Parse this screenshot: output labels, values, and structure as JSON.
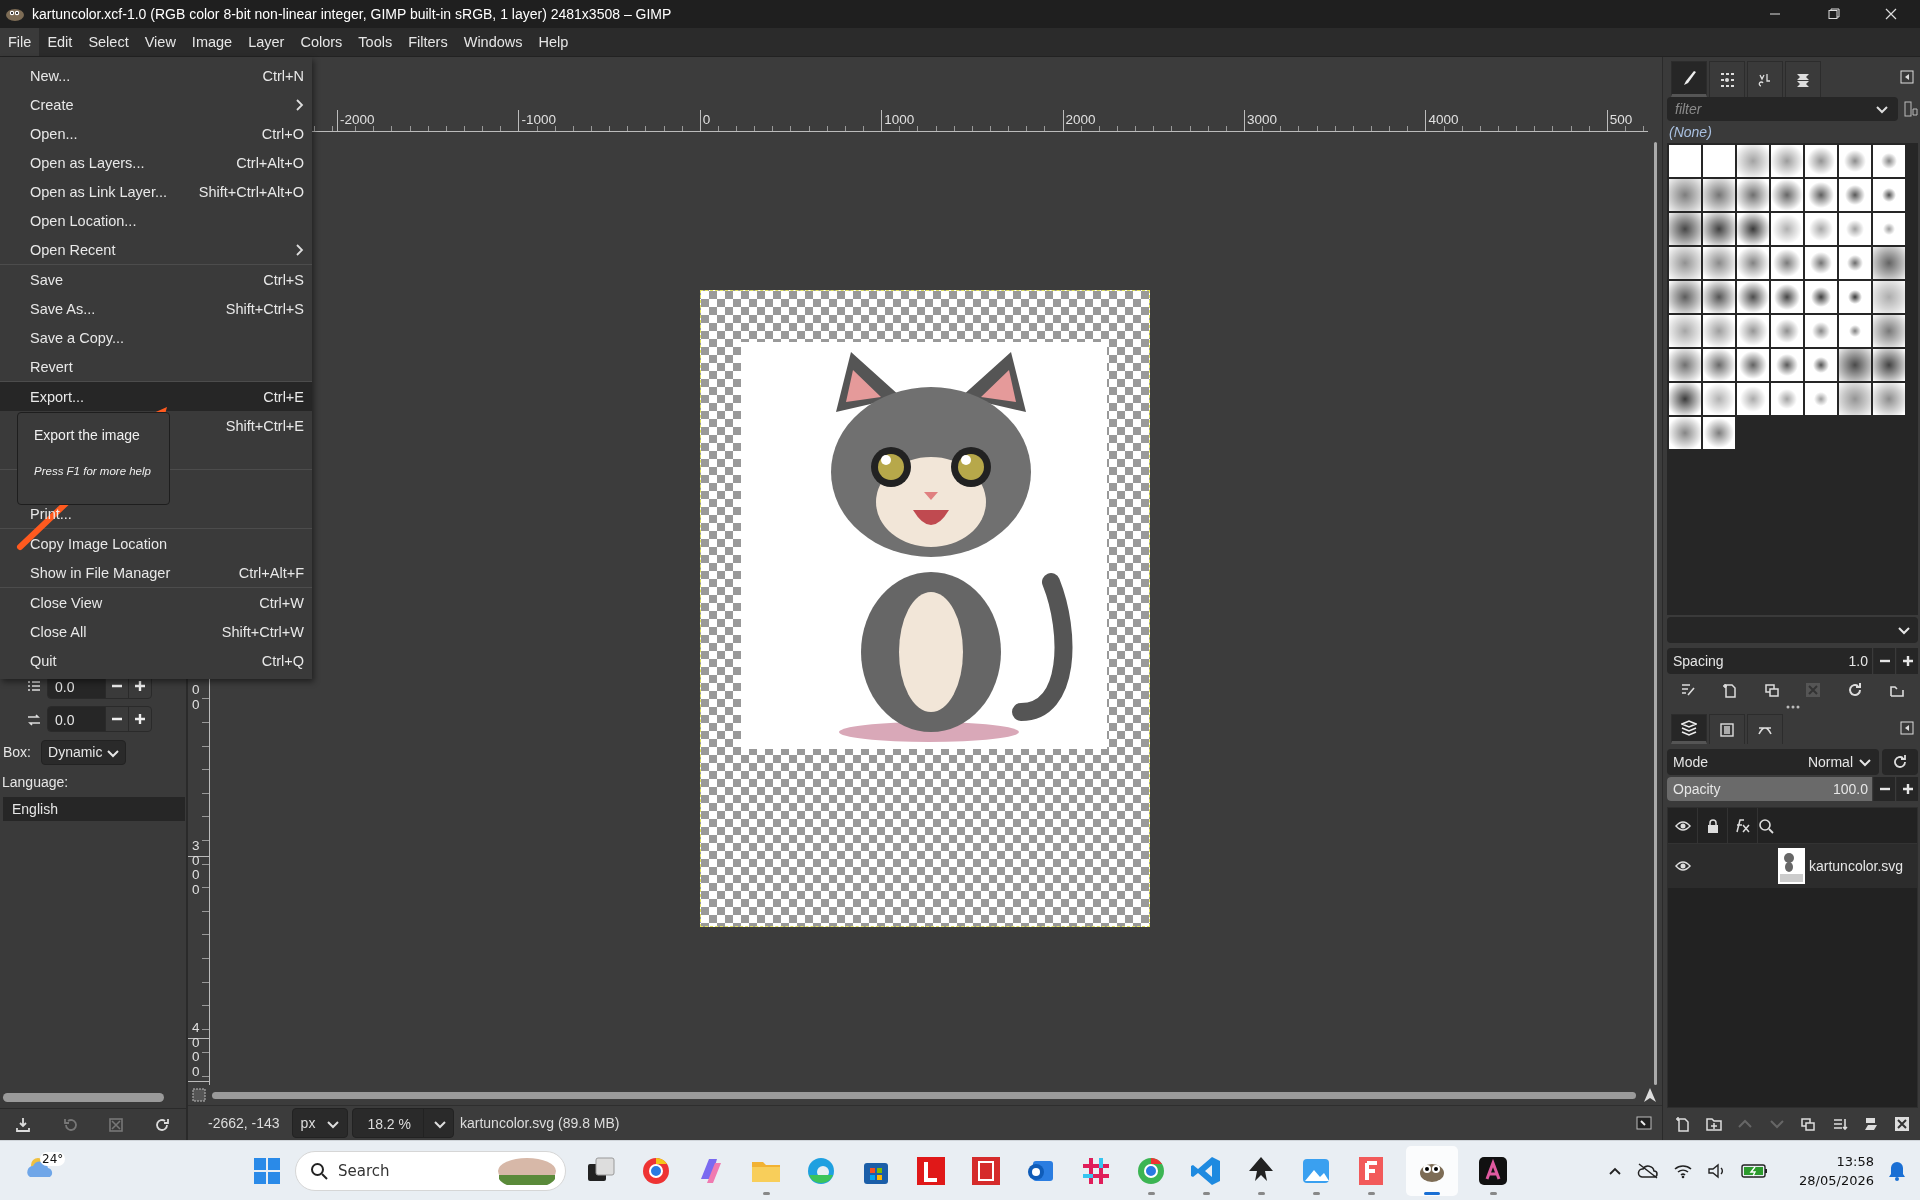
{
  "window": {
    "title": "kartuncolor.xcf-1.0 (RGB color 8-bit non-linear integer, GIMP built-in sRGB, 1 layer) 2481x3508 – GIMP"
  },
  "menubar": [
    {
      "label": "File",
      "selected": true
    },
    {
      "label": "Edit",
      "selected": false
    },
    {
      "label": "Select",
      "selected": false
    },
    {
      "label": "View",
      "selected": false
    },
    {
      "label": "Image",
      "selected": false
    },
    {
      "label": "Layer",
      "selected": false
    },
    {
      "label": "Colors",
      "selected": false
    },
    {
      "label": "Tools",
      "selected": false
    },
    {
      "label": "Filters",
      "selected": false
    },
    {
      "label": "Windows",
      "selected": false
    },
    {
      "label": "Help",
      "selected": false
    }
  ],
  "file_menu": {
    "items": [
      {
        "kind": "item",
        "label": "New...",
        "shortcut": "Ctrl+N",
        "submenu": false,
        "selected": false
      },
      {
        "kind": "item",
        "label": "Create",
        "submenu": true,
        "selected": false
      },
      {
        "kind": "item",
        "label": "Open...",
        "shortcut": "Ctrl+O",
        "submenu": false,
        "selected": false
      },
      {
        "kind": "item",
        "label": "Open as Layers...",
        "shortcut": "Ctrl+Alt+O",
        "submenu": false,
        "selected": false
      },
      {
        "kind": "item",
        "label": "Open as Link Layer...",
        "shortcut": "Shift+Ctrl+Alt+O",
        "submenu": false,
        "selected": false
      },
      {
        "kind": "item",
        "label": "Open Location...",
        "submenu": false,
        "selected": false
      },
      {
        "kind": "item",
        "label": "Open Recent",
        "submenu": true,
        "selected": false
      },
      {
        "kind": "separator"
      },
      {
        "kind": "item",
        "label": "Save",
        "shortcut": "Ctrl+S",
        "submenu": false,
        "selected": false
      },
      {
        "kind": "item",
        "label": "Save As...",
        "shortcut": "Shift+Ctrl+S",
        "submenu": false,
        "selected": false
      },
      {
        "kind": "item",
        "label": "Save a Copy...",
        "submenu": false,
        "selected": false
      },
      {
        "kind": "item",
        "label": "Revert",
        "submenu": false,
        "selected": false
      },
      {
        "kind": "separator"
      },
      {
        "kind": "item",
        "label": "Export...",
        "shortcut": "Ctrl+E",
        "submenu": false,
        "selected": true
      },
      {
        "kind": "item",
        "shortcut": "Shift+Ctrl+E",
        "submenu": false,
        "selected": false
      },
      {
        "kind": "item",
        "submenu": false,
        "selected": false
      },
      {
        "kind": "separator"
      },
      {
        "kind": "item",
        "submenu": false,
        "selected": false
      },
      {
        "kind": "item",
        "label": "Print...",
        "submenu": false,
        "selected": false
      },
      {
        "kind": "separator"
      },
      {
        "kind": "item",
        "label": "Copy Image Location",
        "submenu": false,
        "selected": false
      },
      {
        "kind": "item",
        "label": "Show in File Manager",
        "shortcut": "Ctrl+Alt+F",
        "submenu": false,
        "selected": false
      },
      {
        "kind": "separator"
      },
      {
        "kind": "item",
        "label": "Close View",
        "shortcut": "Ctrl+W",
        "submenu": false,
        "selected": false
      },
      {
        "kind": "item",
        "label": "Close All",
        "shortcut": "Shift+Ctrl+W",
        "submenu": false,
        "selected": false
      },
      {
        "kind": "item",
        "label": "Quit",
        "shortcut": "Ctrl+Q",
        "submenu": false,
        "selected": false
      }
    ]
  },
  "tooltip": {
    "title": "Export the image",
    "hint": "Press F1 for more help"
  },
  "tool_options": {
    "spin_fields": [
      {
        "value": "0.0"
      },
      {
        "value": "0.0"
      }
    ],
    "box": {
      "label": "Box:",
      "value": "Dynamic"
    },
    "language": {
      "label": "Language:",
      "value": "English"
    }
  },
  "rulers": {
    "horizontal": [
      "-2000",
      "-1000",
      "0",
      "1000",
      "2000",
      "3000",
      "4000",
      "500"
    ],
    "vertical": [
      "00",
      "3000",
      "4000"
    ]
  },
  "status_bar": {
    "coordinates": "-2662, -143",
    "unit": "px",
    "zoom": "18.2 %",
    "file_info": "kartuncolor.svg (89.8 MB)"
  },
  "brushes": {
    "tabs": [
      {
        "selected": true
      },
      {
        "selected": false
      },
      {
        "selected": false
      },
      {
        "selected": false
      }
    ],
    "filter_placeholder": "filter",
    "selected_brush": "(None)",
    "spacing": {
      "label": "Spacing",
      "reading": "1.0",
      "level": 0
    }
  },
  "layers": {
    "tabs": [
      {
        "selected": true
      },
      {
        "selected": false
      },
      {
        "selected": false
      }
    ],
    "mode": {
      "label": "Mode",
      "value": "Normal"
    },
    "opacity": {
      "label": "Opacity",
      "reading": "100.0",
      "level": 1
    },
    "items": [
      {
        "name": "kartuncolor.svg",
        "visible": true
      }
    ]
  },
  "taskbar": {
    "weather": "24°",
    "search_placeholder": "Search",
    "apps": [
      {
        "running": false,
        "selected": false
      },
      {
        "running": false,
        "selected": false
      },
      {
        "running": false,
        "selected": false
      },
      {
        "running": true,
        "selected": false
      },
      {
        "running": false,
        "selected": false
      },
      {
        "running": false,
        "selected": false
      },
      {
        "running": false,
        "selected": false
      },
      {
        "running": false,
        "selected": false
      },
      {
        "running": false,
        "selected": false
      },
      {
        "running": false,
        "selected": false
      },
      {
        "running": true,
        "selected": false
      },
      {
        "running": true,
        "selected": false
      },
      {
        "running": true,
        "selected": false
      },
      {
        "running": true,
        "selected": false
      },
      {
        "running": true,
        "selected": false
      },
      {
        "running": true,
        "selected": true
      },
      {
        "running": true,
        "selected": false
      }
    ],
    "time": "13:58",
    "date": "28/05/2026"
  }
}
